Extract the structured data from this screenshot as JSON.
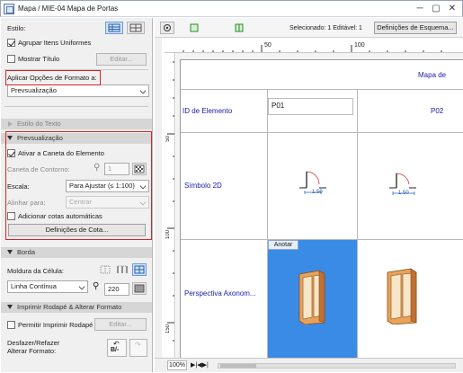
{
  "window": {
    "title": "Mapa / MIE-04 Mapa de Portas",
    "minimize": "─",
    "maximize": "▢",
    "close": "✕"
  },
  "panel": {
    "style_label": "Estilo:",
    "group_uniform_label": "Agrupar Itens Uniformes",
    "show_title_label": "Mostrar Título",
    "edit_button": "Editar...",
    "apply_format_label": "Aplicar Opções de Formato a:",
    "apply_format_value": "Prevsualização",
    "text_style_section": "Estilo do Texto",
    "preview_section": "Prevsualização",
    "activate_pen_label": "Ativar a Caneta do Elemento",
    "contour_pen_label": "Caneta de Contorno:",
    "contour_pen_value": "1",
    "scale_label": "Escala:",
    "scale_value": "Para Ajustar (≤ 1:100)",
    "align_label": "Alinhar para:",
    "align_value": "Centrar",
    "auto_dims_label": "Adicionar cotas automáticas",
    "dim_settings_button": "Definições de Cota...",
    "border_section": "Borda",
    "cell_frame_label": "Moldura da Célula:",
    "line_type_value": "Linha Contínua",
    "line_pen_value": "220",
    "print_section": "Imprimir Rodapé & Alterar Formato",
    "print_footer_label": "Permitir Imprimir Rodapé",
    "print_edit_button": "Editar...",
    "undo_label": "Desfazer/Refazer",
    "undo_label2": "Alterar Formato:",
    "undo_icon": "B/-"
  },
  "toolbar": {
    "selected_text": "Selecionado: 1  Editável: 1",
    "scheme_button": "Definições de Esquema..."
  },
  "ruler": {
    "top_ticks": [
      "50",
      "100"
    ],
    "left_ticks": [
      "50",
      "100",
      "150"
    ]
  },
  "schedule": {
    "title": "Mapa de",
    "rows": [
      {
        "label": "ID de Elemento",
        "v1": "P01",
        "v2": "P02"
      },
      {
        "label": "Símbolo 2D",
        "dim1": "1.50",
        "dim2": "1.50"
      },
      {
        "label": "Perspectiva Axonom...",
        "annotate": "Anotar"
      }
    ]
  },
  "status": {
    "zoom": "100%",
    "nav": "▶|◀▶|"
  }
}
